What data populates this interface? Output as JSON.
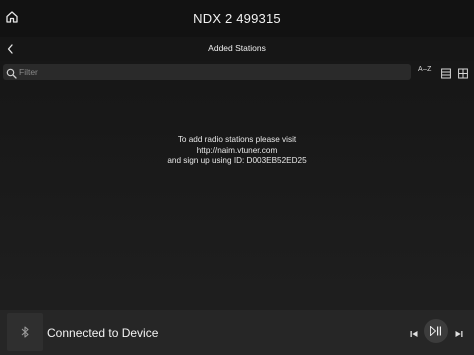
{
  "header": {
    "device_name": "NDX 2 499315",
    "home_icon": "home-icon"
  },
  "subheader": {
    "title": "Added Stations",
    "back_icon": "chevron-left-icon"
  },
  "filter": {
    "placeholder": "Filter",
    "search_icon": "search-icon",
    "sort_label": "A–Z",
    "list_icon": "list-view-icon",
    "grid_icon": "grid-view-icon"
  },
  "empty_state": {
    "line1": "To add radio stations please visit",
    "line2": "http://naim.vtuner.com",
    "line3": "and sign up using ID: D003EB52ED25"
  },
  "player": {
    "status": "Connected to Device",
    "source_icon": "bluetooth-icon",
    "prev_icon": "skip-previous-icon",
    "play_pause_icon": "play-pause-icon",
    "next_icon": "skip-next-icon"
  },
  "colors": {
    "background": "#1a1a1a",
    "header": "#121212",
    "player_bar": "#262626",
    "text": "#ffffff"
  }
}
